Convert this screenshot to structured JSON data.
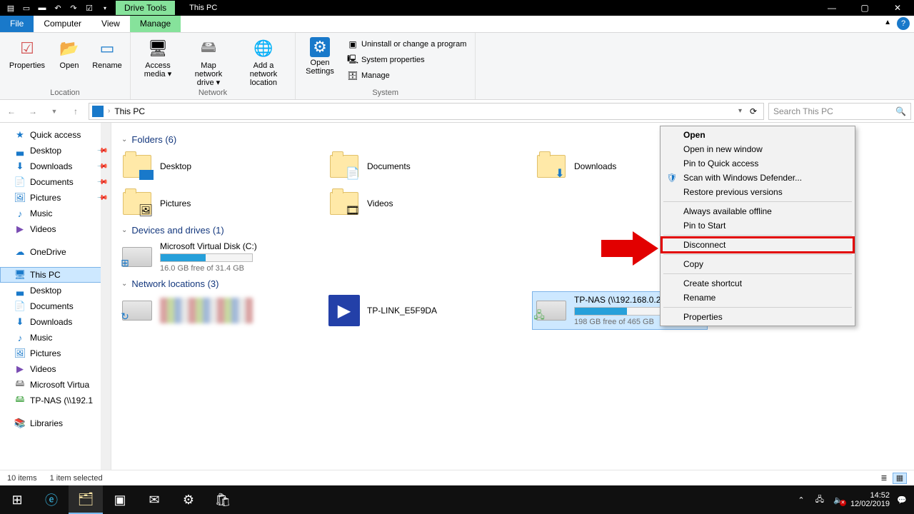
{
  "titlebar": {
    "context_tab": "Drive Tools",
    "title": "This PC"
  },
  "ribbon_tabs": {
    "file": "File",
    "computer": "Computer",
    "view": "View",
    "manage": "Manage"
  },
  "ribbon": {
    "location": {
      "properties": "Properties",
      "open": "Open",
      "rename": "Rename",
      "label": "Location"
    },
    "network": {
      "access_media": "Access media",
      "map_drive": "Map network drive",
      "add_location": "Add a network location",
      "label": "Network"
    },
    "system": {
      "open_settings": "Open Settings",
      "uninstall": "Uninstall or change a program",
      "sys_props": "System properties",
      "manage": "Manage",
      "label": "System"
    }
  },
  "nav": {
    "location": "This PC",
    "search_placeholder": "Search This PC"
  },
  "sidebar": {
    "quick": "Quick access",
    "quick_items": [
      "Desktop",
      "Downloads",
      "Documents",
      "Pictures",
      "Music",
      "Videos"
    ],
    "onedrive": "OneDrive",
    "thispc": "This PC",
    "pc_items": [
      "Desktop",
      "Documents",
      "Downloads",
      "Music",
      "Pictures",
      "Videos",
      "Microsoft Virtua",
      "TP-NAS (\\\\192.1"
    ],
    "libraries": "Libraries"
  },
  "content": {
    "folders": {
      "header": "Folders (6)",
      "items": [
        "Desktop",
        "Documents",
        "Downloads",
        "Pictures",
        "Videos"
      ]
    },
    "devices": {
      "header": "Devices and drives (1)",
      "c": {
        "name": "Microsoft Virtual Disk (C:)",
        "free": "16.0 GB free of 31.4 GB",
        "pct": 49
      }
    },
    "network": {
      "header": "Network locations (3)",
      "media": "TP-LINK_E5F9DA",
      "nas": {
        "name": "TP-NAS (\\\\192.168.0.254) (Z:)",
        "free": "198 GB free of 465 GB",
        "pct": 57
      }
    }
  },
  "context_menu": {
    "open": "Open",
    "open_new": "Open in new window",
    "pin_quick": "Pin to Quick access",
    "defender": "Scan with Windows Defender...",
    "restore": "Restore previous versions",
    "offline": "Always available offline",
    "pin_start": "Pin to Start",
    "disconnect": "Disconnect",
    "copy": "Copy",
    "shortcut": "Create shortcut",
    "rename": "Rename",
    "properties": "Properties"
  },
  "status": {
    "items": "10 items",
    "selected": "1 item selected"
  },
  "taskbar": {
    "time": "14:52",
    "date": "12/02/2019"
  }
}
